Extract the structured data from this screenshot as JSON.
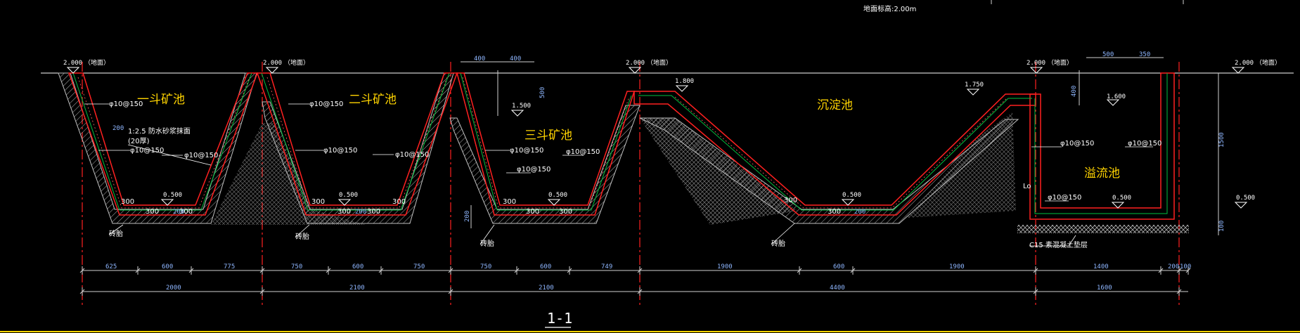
{
  "header_note": "地面标高:2.00m",
  "section_title": "1-1",
  "pools": [
    {
      "key": "p1",
      "label": "一斗矿池"
    },
    {
      "key": "p2",
      "label": "二斗矿池"
    },
    {
      "key": "p3",
      "label": "三斗矿池"
    },
    {
      "key": "p4",
      "label": "沉淀池"
    },
    {
      "key": "p5",
      "label": "溢流池"
    }
  ],
  "elevations": [
    {
      "key": "e1",
      "value": "2.000",
      "note": "（地面）"
    },
    {
      "key": "e2",
      "value": "2.000",
      "note": "（地面）"
    },
    {
      "key": "e3",
      "value": "2.000",
      "note": "（地面）"
    },
    {
      "key": "e4",
      "value": "2.000",
      "note": "（地面）"
    },
    {
      "key": "e5",
      "value": "2.000",
      "note": "（地面）"
    },
    {
      "key": "e6",
      "value": "1.800",
      "note": ""
    },
    {
      "key": "e7",
      "value": "1.750",
      "note": ""
    },
    {
      "key": "e8",
      "value": "1.500",
      "note": ""
    },
    {
      "key": "e9",
      "value": "1.600",
      "note": ""
    },
    {
      "key": "b1",
      "value": "0.500",
      "note": ""
    },
    {
      "key": "b2",
      "value": "0.500",
      "note": ""
    },
    {
      "key": "b3",
      "value": "0.500",
      "note": ""
    },
    {
      "key": "b4",
      "value": "0.500",
      "note": ""
    },
    {
      "key": "b5",
      "value": "0.500",
      "note": ""
    },
    {
      "key": "b6",
      "value": "0.500",
      "note": ""
    }
  ],
  "rebar_labels": [
    "φ10@150",
    "φ10@150",
    "φ10@150",
    "φ10@150",
    "φ10@150",
    "φ10@150",
    "φ10@150",
    "φ10@150",
    "φ10@150",
    "φ10@150",
    "φ10@150",
    "φ10@150"
  ],
  "notes": {
    "plaster": "1:2.5 防水砂浆抹面",
    "plaster2": "(20厚)",
    "brick1": "砖胎",
    "brick2": "砖胎",
    "brick3": "砖胎",
    "brick4": "砖胎",
    "cushion": "C15 素混凝土垫层",
    "lo": "Lo"
  },
  "dims_row1": [
    "625",
    "600",
    "775",
    "750",
    "600",
    "750",
    "750",
    "600",
    "749",
    "1900",
    "600",
    "1900",
    "1400",
    "200",
    "100"
  ],
  "dims_row2": [
    "2000",
    "2100",
    "2100",
    "4400",
    "1600"
  ],
  "dims_top": [
    "400",
    "400",
    "500",
    "350"
  ],
  "dims_vert": [
    "500",
    "400",
    "1500",
    "200",
    "100"
  ],
  "thickness": [
    "300",
    "300",
    "300",
    "300",
    "300",
    "300",
    "300",
    "300",
    "300",
    "300",
    "300",
    "300",
    "200",
    "200",
    "200",
    "200"
  ],
  "colors": {
    "concrete": "#ff2020",
    "hatch": "#b0b0b0",
    "rebar": "#00c040",
    "dim": "#8fb7ff",
    "pool_label": "#ffd400",
    "axis": "#ff2020"
  }
}
